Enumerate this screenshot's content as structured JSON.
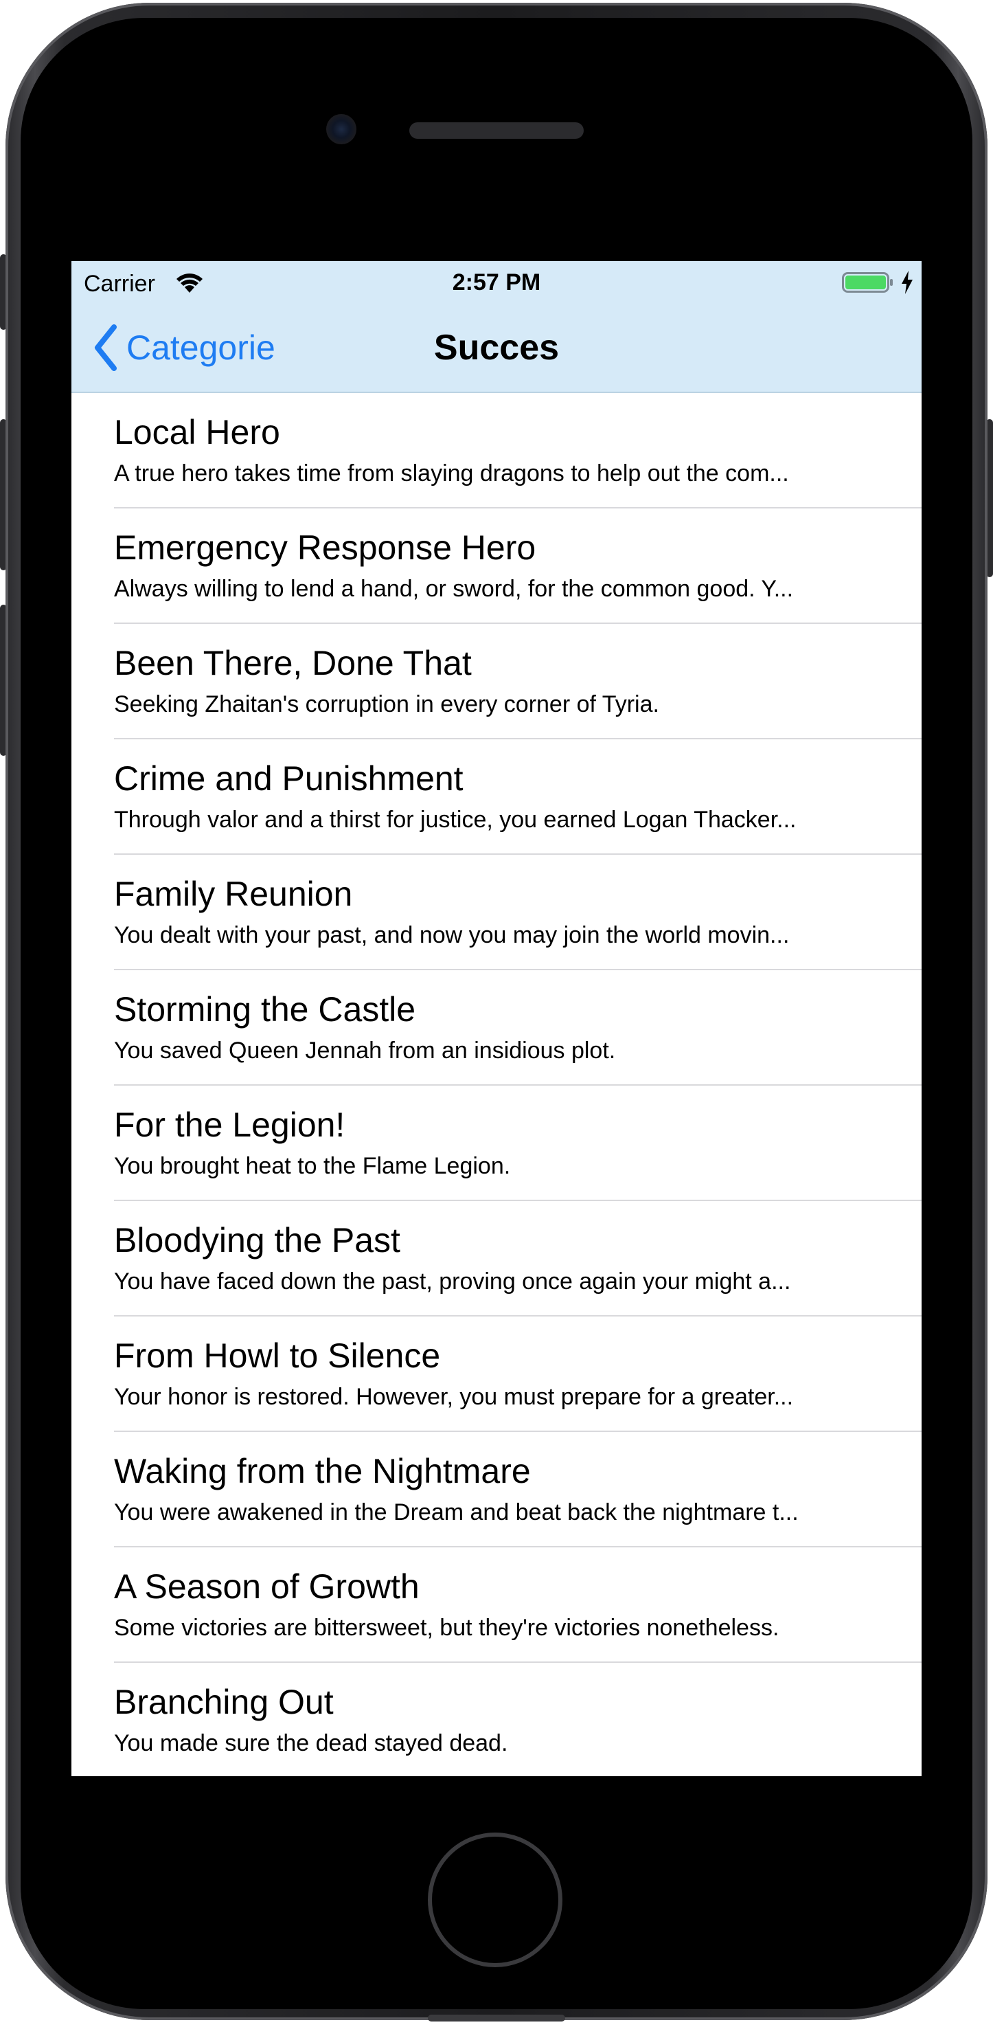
{
  "status_bar": {
    "carrier": "Carrier",
    "time": "2:57 PM"
  },
  "nav": {
    "back_label": "Categorie",
    "title": "Succes"
  },
  "colors": {
    "header_bg": "#d6eaf8",
    "accent": "#1e7cf2",
    "battery_fill": "#4cd964"
  },
  "achievements": [
    {
      "title": "Local Hero",
      "description": "A true hero takes time from slaying dragons to help out the com..."
    },
    {
      "title": "Emergency Response Hero",
      "description": "Always willing to lend a hand, or sword, for the common good. Y..."
    },
    {
      "title": "Been There, Done That",
      "description": "Seeking Zhaitan's corruption in every corner of Tyria."
    },
    {
      "title": "Crime and Punishment",
      "description": "Through valor and a thirst for justice, you earned Logan Thacker..."
    },
    {
      "title": "Family Reunion",
      "description": "You dealt with your past, and now you may join the world movin..."
    },
    {
      "title": "Storming the Castle",
      "description": "You saved Queen Jennah from an insidious plot."
    },
    {
      "title": "For the Legion!",
      "description": "You brought heat to the Flame Legion."
    },
    {
      "title": "Bloodying the Past",
      "description": "You have faced down the past, proving once again your might a..."
    },
    {
      "title": "From Howl to Silence",
      "description": "Your honor is restored. However, you must prepare for a greater..."
    },
    {
      "title": "Waking from the Nightmare",
      "description": "You were awakened in the Dream and beat back the nightmare t..."
    },
    {
      "title": "A Season of Growth",
      "description": "Some victories are bittersweet, but they're victories nonetheless."
    },
    {
      "title": "Branching Out",
      "description": "You made sure the dead stayed dead."
    }
  ]
}
